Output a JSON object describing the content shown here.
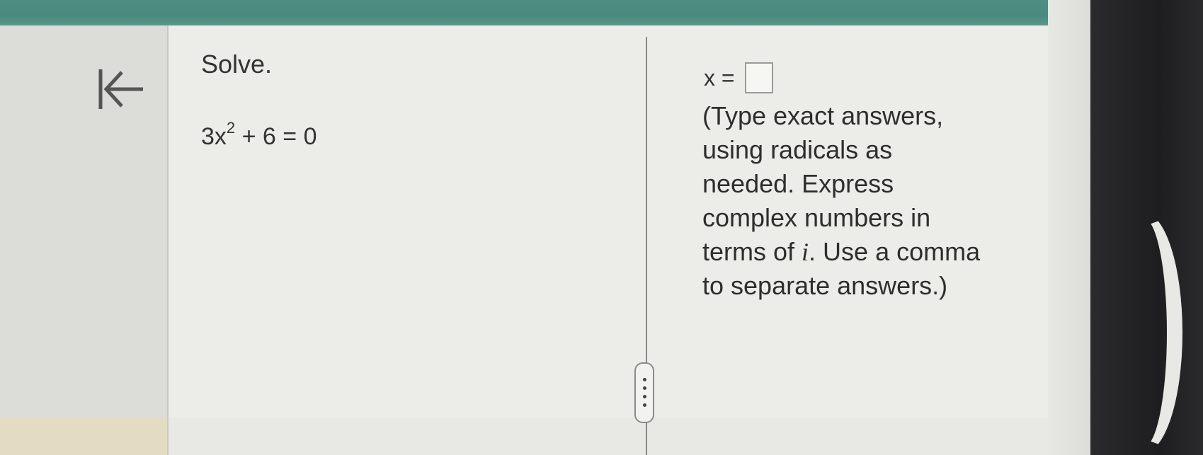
{
  "problem": {
    "instruction": "Solve.",
    "equation": {
      "coefficient": "3x",
      "exponent": "2",
      "rest": " + 6 = 0"
    }
  },
  "answer": {
    "variable": "x =",
    "value": ""
  },
  "hint": {
    "lines": [
      "(Type exact answers,",
      "using radicals as",
      "needed. Express",
      "complex numbers in",
      "terms of ",
      ". Use a comma",
      "to separate answers.)"
    ],
    "italic_symbol": "i"
  },
  "icons": {
    "back": "first-page-arrow-icon",
    "resize_handle": "vertical-dots-grip-icon"
  },
  "colors": {
    "header_teal": "#4f8e82",
    "text": "#333333"
  }
}
